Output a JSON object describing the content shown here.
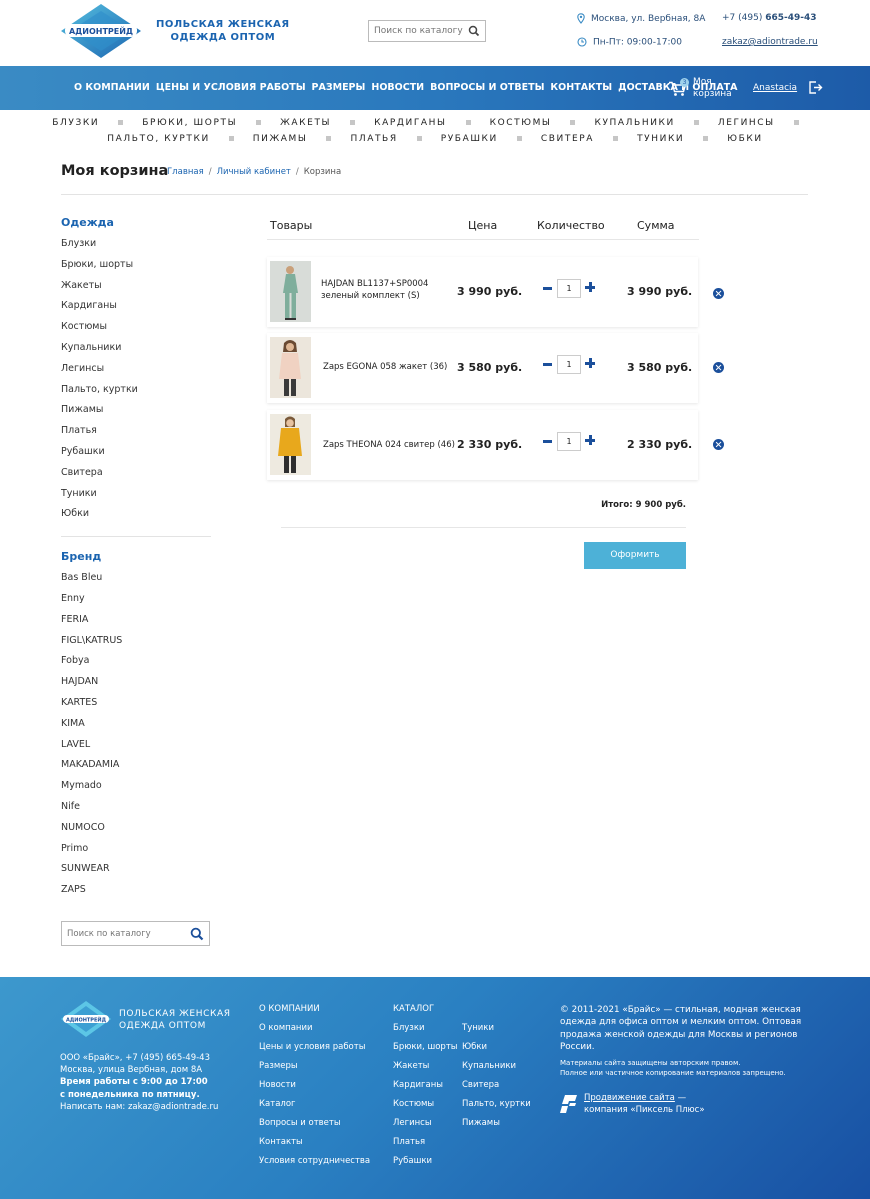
{
  "header": {
    "logo_text": "АДИОНТРЕЙД",
    "tagline": [
      "ПОЛЬСКАЯ ЖЕНСКАЯ",
      "ОДЕЖДА ОПТОМ"
    ],
    "search_placeholder": "Поиск по каталогу",
    "address": "Москва, ул. Вербная, 8А",
    "hours": "Пн-Пт: 09:00-17:00",
    "phone_prefix": "+7 (495) ",
    "phone_main": "665-49-43",
    "email": "zakaz@adiontrade.ru"
  },
  "nav": {
    "items": [
      "О КОМПАНИИ",
      "ЦЕНЫ И УСЛОВИЯ РАБОТЫ",
      "РАЗМЕРЫ",
      "НОВОСТИ",
      "ВОПРОСЫ И ОТВЕТЫ",
      "КОНТАКТЫ",
      "ДОСТАВКА И ОПЛАТА"
    ],
    "cart_count": "3",
    "cart_label": [
      "Моя",
      "корзина"
    ],
    "user": "Anastacia"
  },
  "categories": {
    "row1": [
      "БЛУЗКИ",
      "БРЮКИ, ШОРТЫ",
      "ЖАКЕТЫ",
      "КАРДИГАНЫ",
      "КОСТЮМЫ",
      "КУПАЛЬНИКИ",
      "ЛЕГИНСЫ"
    ],
    "row2": [
      "ПАЛЬТО, КУРТКИ",
      "ПИЖАМЫ",
      "ПЛАТЬЯ",
      "РУБАШКИ",
      "СВИТЕРА",
      "ТУНИКИ",
      "ЮБКИ"
    ]
  },
  "page": {
    "title": "Моя корзина",
    "breadcrumb": [
      "Главная",
      "Личный кабинет",
      "Корзина"
    ]
  },
  "sidebar": {
    "clothing_heading": "Одежда",
    "clothing": [
      "Блузки",
      "Брюки, шорты",
      "Жакеты",
      "Кардиганы",
      "Костюмы",
      "Купальники",
      "Легинсы",
      "Пальто, куртки",
      "Пижамы",
      "Платья",
      "Рубашки",
      "Свитера",
      "Туники",
      "Юбки"
    ],
    "brand_heading": "Бренд",
    "brands": [
      "Bas Bleu",
      "Enny",
      "FERIA",
      "FIGL\\KATRUS",
      "Fobya",
      "HAJDAN",
      "KARTES",
      "KIMA",
      "LAVEL",
      "MAKADAMIA",
      "Mymado",
      "Nife",
      "NUMOCO",
      "Primo",
      "SUNWEAR",
      "ZAPS"
    ],
    "search_placeholder": "Поиск по каталогу"
  },
  "cart": {
    "headers": {
      "goods": "Товары",
      "price": "Цена",
      "qty": "Количество",
      "sum": "Сумма"
    },
    "items": [
      {
        "name": [
          "HAJDAN BL1137+SP0004",
          "зеленый комплект (S)"
        ],
        "price": "3 990 руб.",
        "qty": "1",
        "sum": "3 990 руб."
      },
      {
        "name": [
          "Zaps EGONA 058 жакет (36)"
        ],
        "price": "3 580 руб.",
        "qty": "1",
        "sum": "3 580 руб."
      },
      {
        "name": [
          "Zaps THEONA 024 свитер (46)"
        ],
        "price": "2 330 руб.",
        "qty": "1",
        "sum": "2 330 руб."
      }
    ],
    "total": "Итого: 9 900 руб.",
    "checkout": "Оформить"
  },
  "footer": {
    "tagline": [
      "ПОЛЬСКАЯ ЖЕНСКАЯ",
      "ОДЕЖДА ОПТОМ"
    ],
    "info": [
      "ООО «Брайс», +7 (495) 665-49-43",
      "Москва, улица Вербная, дом 8А"
    ],
    "hours_bold": [
      "Время работы с 9:00 до 17:00",
      "с понедельника по пятницу."
    ],
    "email_line": "Написать нам: zakaz@adiontrade.ru",
    "company_heading": "О КОМПАНИИ",
    "company_links": [
      "О компании",
      "Цены и условия работы",
      "Размеры",
      "Новости",
      "Каталог",
      "Вопросы и ответы",
      "Контакты",
      "Условия сотрудничества"
    ],
    "catalog_heading": "КАТАЛОГ",
    "catalog_col1": [
      "Блузки",
      "Брюки, шорты",
      "Жакеты",
      "Кардиганы",
      "Костюмы",
      "Легинсы",
      "Платья",
      "Рубашки"
    ],
    "catalog_col2": [
      "Туники",
      "Юбки",
      "Купальники",
      "Свитера",
      "Пальто, куртки",
      "Пижамы"
    ],
    "copyright": "© 2011-2021 «Брайс» — стильная, модная женская одежда для офиса оптом и мелким оптом. Оптовая продажа женской одежды для Москвы и регионов России.",
    "legal": [
      "Материалы сайта защищены авторским правом.",
      "Полное или частичное копирование материалов запрещено."
    ],
    "promo_link": "Продвижение сайта",
    "promo_dash": " —",
    "promo_company": "компания «Пиксель Плюс»"
  }
}
